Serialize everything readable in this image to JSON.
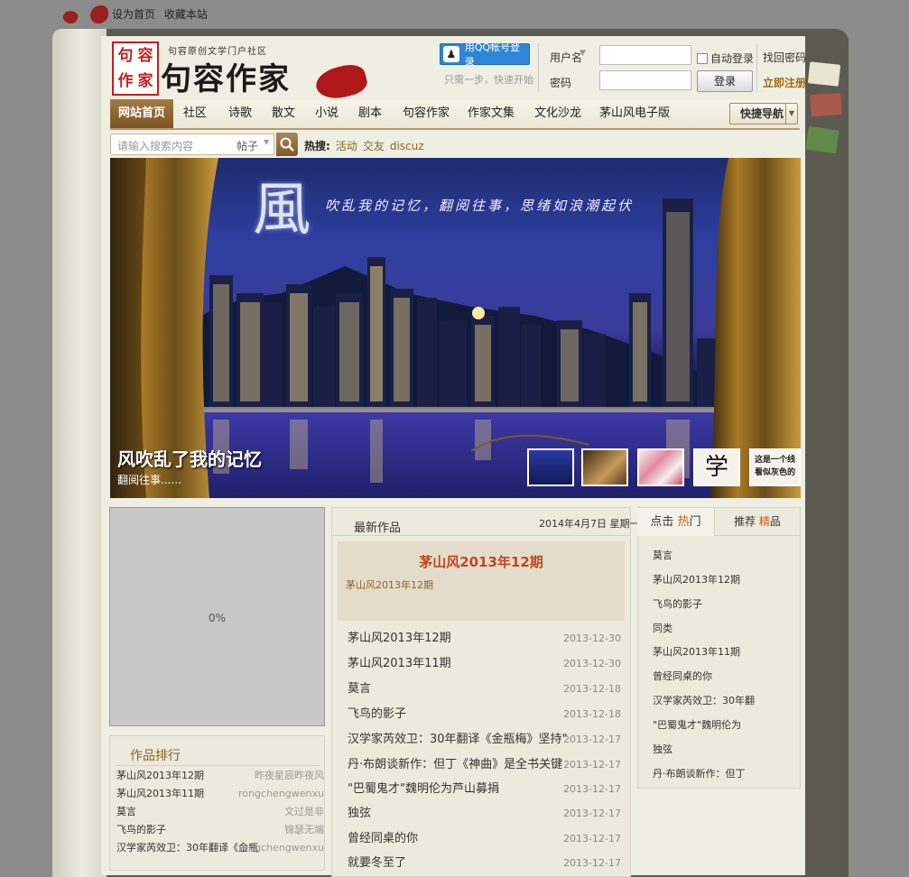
{
  "topbar": {
    "set_home": "设为首页",
    "bookmark": "收藏本站"
  },
  "logo": {
    "seal_chars": [
      "句",
      "容",
      "作",
      "家"
    ],
    "subtitle": "句容原创文学门户社区",
    "name": "句容作家"
  },
  "login": {
    "qq_label": "用QQ帐号登录",
    "qq_hint": "只需一步，快速开始",
    "username_label": "用户名",
    "password_label": "密码",
    "username_value": "",
    "password_value": "",
    "auto_login_label": "自动登录",
    "login_button": "登录",
    "forgot_label": "找回密码",
    "register_label": "立即注册"
  },
  "nav": {
    "items": [
      "网站首页",
      "社区",
      "诗歌",
      "散文",
      "小说",
      "剧本",
      "句容作家",
      "作家文集",
      "文化沙龙",
      "茅山风电子版"
    ],
    "active_index": 0,
    "quick_nav": "快捷导航"
  },
  "search": {
    "placeholder": "请输入搜索内容",
    "type": "帖子",
    "hot_label": "热搜:",
    "hot_terms": [
      "活动",
      "交友",
      "discuz"
    ]
  },
  "banner": {
    "feng_char": "風",
    "poem": "吹乱我的记忆，翻阅往事，思绪如浪潮起伏",
    "title": "风吹乱了我的记忆",
    "subtitle": "翻阅往事......",
    "thumb_text_1": "学",
    "thumb_text_2a": "这是一个线",
    "thumb_text_2b": "看似灰色的"
  },
  "loader": {
    "percent": "0%"
  },
  "ranking": {
    "title": "作品排行",
    "rows": [
      {
        "title": "茅山风2013年12期",
        "author": "昨夜星辰昨夜风"
      },
      {
        "title": "茅山风2013年11期",
        "author": "rongchengwenxu"
      },
      {
        "title": "莫言",
        "author": "文过是非"
      },
      {
        "title": "飞鸟的影子",
        "author": "锦瑟无端"
      },
      {
        "title": "汉学家芮效卫：30年翻译《金瓶",
        "author": "rongchengwenxu"
      }
    ]
  },
  "latest": {
    "title": "最新作品",
    "date": "2014年4月7日 星期一",
    "featured_title": "茅山风2013年12期",
    "featured_sub": "茅山风2013年12期",
    "rows": [
      {
        "title": "茅山风2013年12期",
        "date": "2013-12-30"
      },
      {
        "title": "茅山风2013年11期",
        "date": "2013-12-30"
      },
      {
        "title": "莫言",
        "date": "2013-12-18"
      },
      {
        "title": "飞鸟的影子",
        "date": "2013-12-18"
      },
      {
        "title": "汉学家芮效卫：30年翻译《金瓶梅》坚持\"",
        "date": "2013-12-17"
      },
      {
        "title": "丹·布朗谈新作：但丁《神曲》是全书关键",
        "date": "2013-12-17"
      },
      {
        "title": "\"巴蜀鬼才\"魏明伦为芦山募捐",
        "date": "2013-12-17"
      },
      {
        "title": "独弦",
        "date": "2013-12-17"
      },
      {
        "title": "曾经同桌的你",
        "date": "2013-12-17"
      },
      {
        "title": "就要冬至了",
        "date": "2013-12-17"
      }
    ]
  },
  "hot_panel": {
    "tab_hot_prefix": "点击",
    "tab_hot_hl": "热",
    "tab_hot_suffix": "门",
    "tab_rec_prefix": "推荐",
    "tab_rec_hl": "精",
    "tab_rec_suffix": "品",
    "items": [
      "莫言",
      "茅山风2013年12期",
      "飞鸟的影子",
      "同类",
      "茅山风2013年11期",
      "曾经同桌的你",
      "汉学家芮效卫：30年翻",
      "\"巴蜀鬼才\"魏明伦为",
      "独弦",
      "丹·布朗谈新作：但丁"
    ]
  },
  "colors": {
    "accent": "#7b5424",
    "hot": "#d05a14",
    "featured_title": "#c0481e",
    "bg": "#8c8c8c"
  }
}
